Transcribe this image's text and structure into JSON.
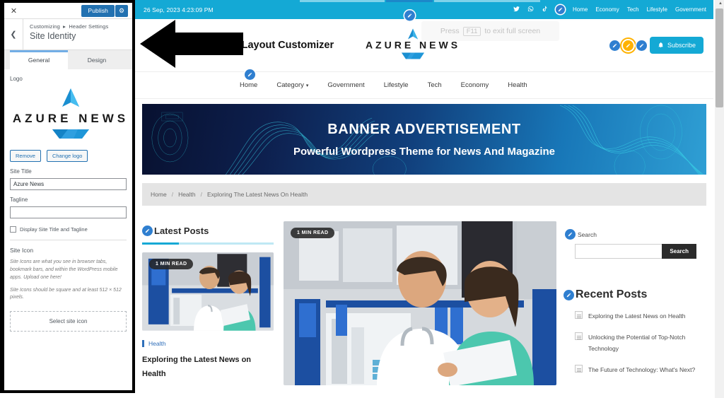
{
  "customizer": {
    "close_icon": "close-icon",
    "publish_label": "Publish",
    "gear_icon": "gear-icon",
    "back_icon": "chevron-left-icon",
    "breadcrumb_root": "Customizing",
    "breadcrumb_sep": "▸",
    "breadcrumb_parent": "Header Settings",
    "panel_title": "Site Identity",
    "tabs": [
      {
        "label": "General",
        "active": true
      },
      {
        "label": "Design",
        "active": false
      }
    ],
    "logo": {
      "label": "Logo",
      "brand_text": "AZURE NEWS",
      "remove_label": "Remove",
      "change_label": "Change logo"
    },
    "site_title": {
      "label": "Site Title",
      "value": "Azure News"
    },
    "tagline": {
      "label": "Tagline",
      "value": ""
    },
    "display_checkbox": {
      "label": "Display Site Title and Tagline",
      "checked": false
    },
    "site_icon": {
      "label": "Site Icon",
      "desc1": "Site Icons are what you see in browser tabs, bookmark bars, and within the WordPress mobile apps. Upload one here!",
      "desc2": "Site Icons should be square and at least 512 × 512 pixels.",
      "select_label": "Select site icon"
    }
  },
  "overlay": {
    "fullscreen_hint_pre": "Press",
    "fullscreen_key": "F11",
    "fullscreen_hint_post": "to exit full screen",
    "arrow_icon": "left-arrow-pointer"
  },
  "site": {
    "topbar": {
      "date": "26 Sep, 2023 4:23:09 PM",
      "social": [
        {
          "name": "twitter-icon",
          "glyph": "🐦"
        },
        {
          "name": "whatsapp-icon",
          "glyph": "✆"
        },
        {
          "name": "tiktok-icon",
          "glyph": "♪"
        }
      ],
      "nav": [
        "Home",
        "Economy",
        "Tech",
        "Lifestyle",
        "Government"
      ]
    },
    "header": {
      "page_label": "Site Layout Customizer",
      "brand_text": "AZURE NEWS",
      "subscribe_label": "Subscribe",
      "bell_icon": "bell-icon"
    },
    "mainnav": [
      {
        "label": "Home",
        "dropdown": false
      },
      {
        "label": "Category",
        "dropdown": true
      },
      {
        "label": "Government",
        "dropdown": false
      },
      {
        "label": "Lifestyle",
        "dropdown": false
      },
      {
        "label": "Tech",
        "dropdown": false
      },
      {
        "label": "Economy",
        "dropdown": false
      },
      {
        "label": "Health",
        "dropdown": false
      }
    ],
    "banner": {
      "title": "BANNER  ADVERTISEMENT",
      "subtitle": "Powerful Wordpress Theme for News And Magazine"
    },
    "breadcrumb": {
      "items": [
        "Home",
        "Health",
        "Exploring The Latest News On Health"
      ],
      "separator": "/"
    },
    "latest_posts": {
      "heading": "Latest Posts",
      "post": {
        "read_badge": "1 MIN READ",
        "category": "Health",
        "title": "Exploring the Latest News on Health"
      }
    },
    "featured": {
      "read_badge": "1 MIN READ"
    },
    "sidebar": {
      "search": {
        "label": "Search",
        "value": "",
        "button_label": "Search"
      },
      "recent": {
        "heading": "Recent Posts",
        "items": [
          "Exploring the Latest News on Health",
          "Unlocking the Potential of Top-Notch Technology",
          "The Future of Technology: What's Next?"
        ]
      }
    }
  },
  "colors": {
    "accent": "#14a9d5",
    "wp_blue": "#2271b1",
    "pin_blue": "#2f7fd0",
    "pin_focus": "#ffb200",
    "banner_dark": "#081130",
    "dark_button": "#2b2b2b"
  }
}
